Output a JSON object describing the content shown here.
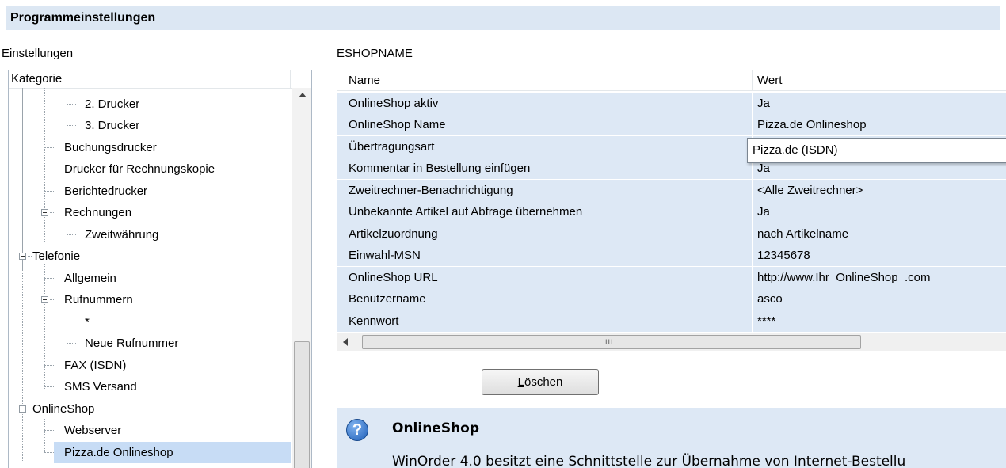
{
  "window": {
    "title": "Programmeinstellungen"
  },
  "left_group": {
    "label": "Einstellungen"
  },
  "right_group": {
    "label": "ESHOPNAME"
  },
  "tree": {
    "header": "Kategorie",
    "items": [
      {
        "label": "2. Drucker"
      },
      {
        "label": "3. Drucker"
      },
      {
        "label": "Buchungsdrucker"
      },
      {
        "label": "Drucker für Rechnungskopie"
      },
      {
        "label": "Berichtedrucker"
      },
      {
        "label": "Rechnungen"
      },
      {
        "label": "Zweitwährung"
      },
      {
        "label": "Telefonie"
      },
      {
        "label": "Allgemein"
      },
      {
        "label": "Rufnummern"
      },
      {
        "label": "*"
      },
      {
        "label": "Neue Rufnummer"
      },
      {
        "label": "FAX (ISDN)"
      },
      {
        "label": "SMS Versand"
      },
      {
        "label": "OnlineShop"
      },
      {
        "label": "Webserver"
      },
      {
        "label": "Pizza.de Onlineshop"
      }
    ],
    "selected": "Pizza.de Onlineshop"
  },
  "grid": {
    "col_name": "Name",
    "col_value": "Wert",
    "rows": [
      {
        "name": "OnlineShop aktiv",
        "value": "Ja"
      },
      {
        "name": "OnlineShop Name",
        "value": "Pizza.de Onlineshop"
      },
      {
        "name": "Übertragungsart",
        "value": ""
      },
      {
        "name": "Kommentar in Bestellung einfügen",
        "value": "Ja"
      },
      {
        "name": "Zweitrechner-Benachrichtigung",
        "value": "<Alle Zweitrechner>"
      },
      {
        "name": "Unbekannte Artikel auf Abfrage übernehmen",
        "value": "Ja"
      },
      {
        "name": "Artikelzuordnung",
        "value": "nach Artikelname"
      },
      {
        "name": "Einwahl-MSN",
        "value": "12345678"
      },
      {
        "name": "OnlineShop URL",
        "value": "http://www.Ihr_OnlineShop_.com"
      },
      {
        "name": "Benutzername",
        "value": "asco"
      },
      {
        "name": "Kennwort",
        "value": "****"
      }
    ],
    "dropdown_value": "Pizza.de (ISDN)"
  },
  "buttons": {
    "delete_prefix": "L",
    "delete_rest": "öschen"
  },
  "info": {
    "title": "OnlineShop",
    "text": "WinOrder 4.0 besitzt eine Schnittstelle zur Übernahme von Internet-Bestellu"
  },
  "colors": {
    "title_bg": "#dce7f3",
    "row_bg": "#dde8f5",
    "selected_bg": "#c7dcf5"
  }
}
